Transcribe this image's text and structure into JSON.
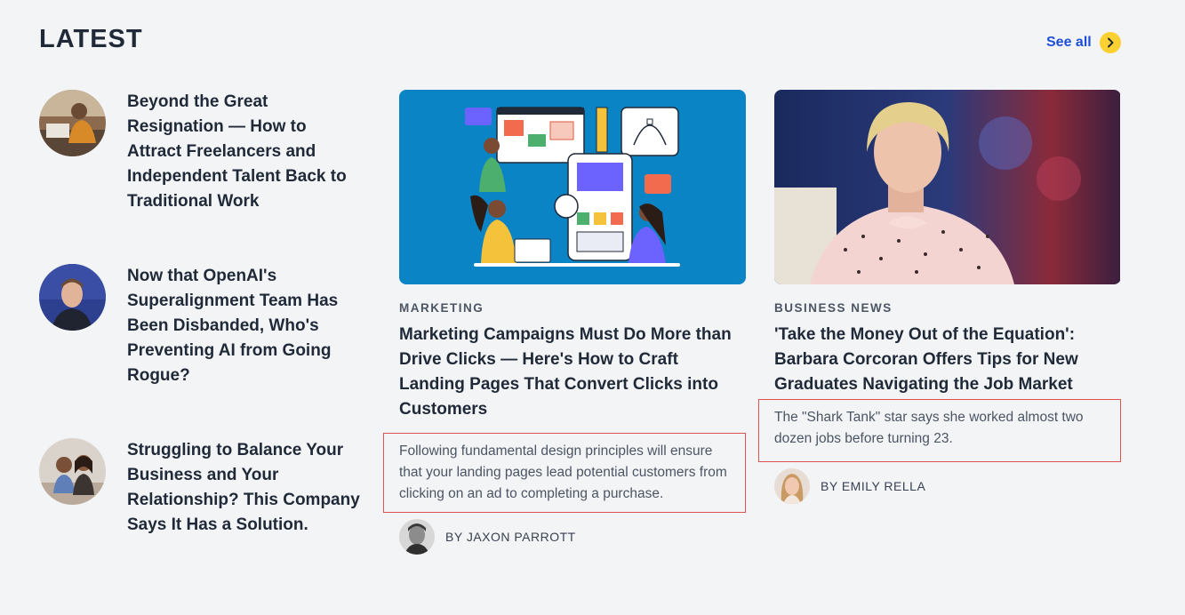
{
  "section": {
    "title": "LATEST",
    "see_all_label": "See all"
  },
  "side_list": [
    {
      "headline": "Beyond the Great Resignation — How to Attract Freelancers and Independent Talent Back to Traditional Work"
    },
    {
      "headline": "Now that OpenAI's Superalignment Team Has Been Disbanded, Who's Preventing AI from Going Rogue?"
    },
    {
      "headline": "Struggling to Balance Your Business and Your Relationship? This Company Says It Has a Solution."
    }
  ],
  "cards": [
    {
      "category": "MARKETING",
      "title": "Marketing Campaigns Must Do More than Drive Clicks — Here's How to Craft Landing Pages That Convert Clicks into Customers",
      "summary": "Following fundamental design principles will ensure that your landing pages lead potential customers from clicking on an ad to completing a purchase.",
      "byline": "BY JAXON PARROTT"
    },
    {
      "category": "BUSINESS NEWS",
      "title": "'Take the Money Out of the Equation': Barbara Corcoran Offers Tips for New Graduates Navigating the Job Market",
      "summary": "The \"Shark Tank\" star says she worked almost two dozen jobs before turning 23.",
      "byline": "BY EMILY RELLA"
    }
  ],
  "colors": {
    "background": "#f3f4f6",
    "link_blue": "#1d4ed8",
    "accent_yellow": "#fbd131",
    "highlight_red": "#e05252",
    "illustration_blue": "#0b84c6"
  }
}
